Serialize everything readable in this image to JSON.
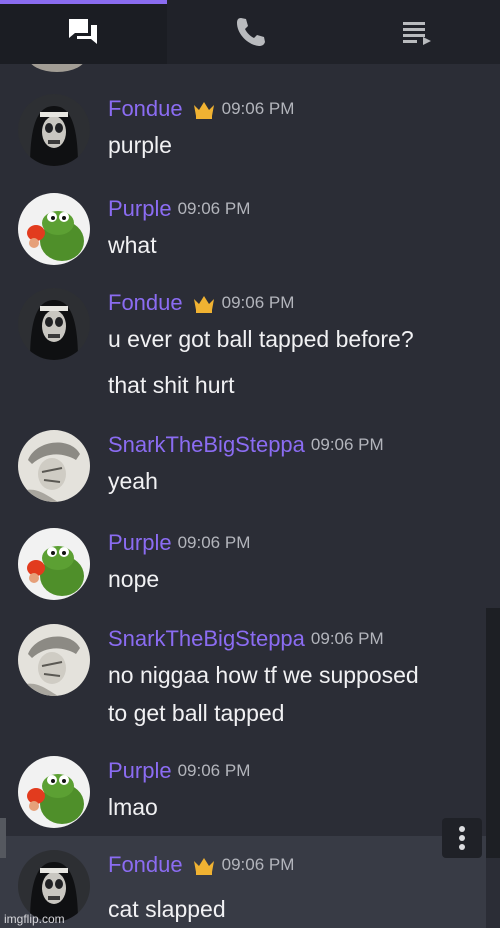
{
  "tabs": [
    {
      "icon": "chat-bubbles-icon",
      "active": true
    },
    {
      "icon": "phone-icon",
      "active": false
    },
    {
      "icon": "member-list-icon",
      "active": false
    }
  ],
  "messages": [
    {
      "user": "Fondue",
      "owner": true,
      "time": "09:06 PM",
      "avatar": "nun-avatar",
      "lines": [
        "purple"
      ]
    },
    {
      "user": "Purple",
      "owner": false,
      "time": "09:06 PM",
      "avatar": "kermit-avatar",
      "lines": [
        "what"
      ]
    },
    {
      "user": "Fondue",
      "owner": true,
      "time": "09:06 PM",
      "avatar": "nun-avatar",
      "lines": [
        "u ever got ball tapped before?",
        "that shit hurt"
      ]
    },
    {
      "user": "SnarkTheBigSteppa",
      "owner": false,
      "time": "09:06 PM",
      "avatar": "sketch-avatar",
      "lines": [
        "yeah"
      ]
    },
    {
      "user": "Purple",
      "owner": false,
      "time": "09:06 PM",
      "avatar": "kermit-avatar",
      "lines": [
        "nope"
      ]
    },
    {
      "user": "SnarkTheBigSteppa",
      "owner": false,
      "time": "09:06 PM",
      "avatar": "sketch-avatar",
      "lines": [
        "no niggaa how tf we supposed",
        "to get ball tapped"
      ]
    },
    {
      "user": "Purple",
      "owner": false,
      "time": "09:06 PM",
      "avatar": "kermit-avatar",
      "lines": [
        "lmao"
      ]
    },
    {
      "user": "Fondue",
      "owner": true,
      "time": "09:06 PM",
      "avatar": "nun-avatar",
      "lines": [
        "cat slapped"
      ]
    }
  ],
  "watermark": "imgflip.com",
  "colors": {
    "accent": "#8b6cf2",
    "crown": "#f0b232",
    "background": "#2b2d36"
  }
}
